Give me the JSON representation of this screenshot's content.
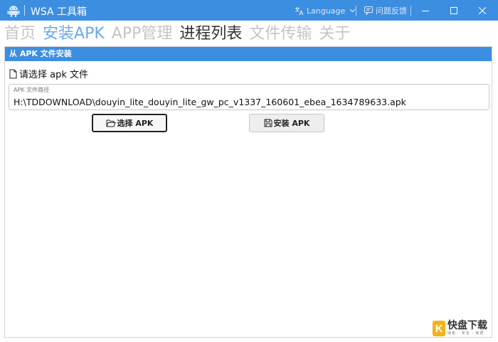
{
  "window": {
    "title": "WSA 工具箱",
    "language_label": "Language",
    "feedback_label": "问题反馈"
  },
  "tabs": [
    {
      "label": "首页",
      "state": "normal"
    },
    {
      "label": "安装APK",
      "state": "selected"
    },
    {
      "label": "APP管理",
      "state": "normal"
    },
    {
      "label": "进程列表",
      "state": "hover"
    },
    {
      "label": "文件传输",
      "state": "normal"
    },
    {
      "label": "关于",
      "state": "normal"
    }
  ],
  "panel": {
    "header": "从 APK 文件安装",
    "choose_label": "请选择 apk 文件",
    "path_field_label": "APK 文件路径",
    "path_value": "H:\\TDDOWNLOAD\\douyin_lite_douyin_lite_gw_pc_v1337_160601_ebea_1634789633.apk",
    "select_button": "选择 APK",
    "install_button": "安装 APK"
  },
  "watermark": {
    "logo_letter": "K",
    "main_text": "快盘下载",
    "sub_text": "绿色 · 安全 · 免费"
  },
  "colors": {
    "accent": "#3c8ee0",
    "tab_selected": "#6ea8e4",
    "tab_normal": "#c4c4c4",
    "tab_hover": "#333333"
  }
}
